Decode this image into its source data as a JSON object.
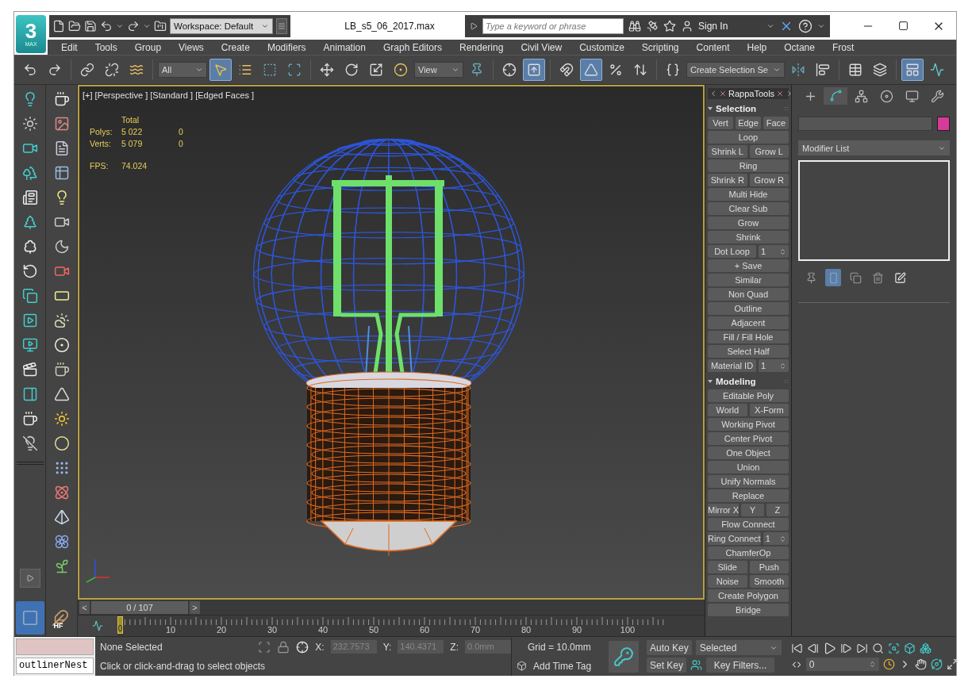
{
  "title_bar": {
    "logo": "3",
    "logo_sub": "MAX",
    "workspace": "Workspace: Default",
    "title": "LB_s5_06_2017.max",
    "search": {
      "placeholder": "Type a keyword or phrase"
    },
    "sign_in": "Sign In"
  },
  "menu": [
    "Edit",
    "Tools",
    "Group",
    "Views",
    "Create",
    "Modifiers",
    "Animation",
    "Graph Editors",
    "Rendering",
    "Civil View",
    "Customize",
    "Scripting",
    "Content",
    "Help",
    "Octane",
    "Frost"
  ],
  "toolbar": [
    {
      "kind": "icon",
      "active": false
    },
    {
      "kind": "icon",
      "active": false
    },
    {
      "kind": "separator"
    },
    {
      "kind": "icon",
      "active": false
    },
    {
      "kind": "icon",
      "active": false
    },
    {
      "kind": "icon",
      "active": false
    },
    {
      "kind": "separator"
    },
    {
      "kind": "dropdown",
      "label": "All"
    },
    {
      "kind": "icon",
      "active": true
    },
    {
      "kind": "icon",
      "active": false
    },
    {
      "kind": "icon",
      "active": false
    },
    {
      "kind": "icon",
      "active": false
    },
    {
      "kind": "separator"
    },
    {
      "kind": "icon",
      "active": false
    },
    {
      "kind": "icon",
      "active": false
    },
    {
      "kind": "icon",
      "active": false
    },
    {
      "kind": "icon",
      "active": false
    },
    {
      "kind": "dropdown",
      "label": "View"
    },
    {
      "kind": "icon",
      "active": false
    },
    {
      "kind": "separator"
    },
    {
      "kind": "icon",
      "active": false
    },
    {
      "kind": "icon",
      "active": true
    },
    {
      "kind": "separator"
    },
    {
      "kind": "icon",
      "active": false
    },
    {
      "kind": "icon",
      "active": true
    },
    {
      "kind": "icon",
      "active": false
    },
    {
      "kind": "icon",
      "active": false
    },
    {
      "kind": "separator"
    },
    {
      "kind": "icon",
      "active": false
    },
    {
      "kind": "dropdown",
      "label": "Create Selection Se"
    },
    {
      "kind": "icon",
      "active": false
    },
    {
      "kind": "icon",
      "active": false
    },
    {
      "kind": "separator"
    },
    {
      "kind": "icon",
      "active": false
    },
    {
      "kind": "icon",
      "active": false
    },
    {
      "kind": "separator"
    },
    {
      "kind": "icon",
      "active": true
    },
    {
      "kind": "icon",
      "active": false
    }
  ],
  "left_toolbar": {
    "hair_badge": "HF"
  },
  "viewport": {
    "label": "[+] [Perspective ] [Standard ] [Edged Faces ]",
    "active": true,
    "stats": {
      "header": "Total",
      "rows": [
        {
          "label": "Polys:",
          "total": "5 022",
          "selected": "0"
        },
        {
          "label": "Verts:",
          "total": "5 079",
          "selected": "0"
        }
      ]
    },
    "fps": {
      "label": "FPS:",
      "value": "74.024"
    }
  },
  "rappa": {
    "title": "RappaTools",
    "sections": [
      {
        "title": "Selection",
        "expanded": true,
        "rows": [
          [
            {
              "kind": "button",
              "label": "Vert"
            },
            {
              "kind": "button",
              "label": "Edge"
            },
            {
              "kind": "button",
              "label": "Face"
            }
          ],
          [
            {
              "kind": "button",
              "label": "Loop"
            }
          ],
          [
            {
              "kind": "button",
              "label": "Shrink L"
            },
            {
              "kind": "button",
              "label": "Grow L"
            }
          ],
          [
            {
              "kind": "button",
              "label": "Ring"
            }
          ],
          [
            {
              "kind": "button",
              "label": "Shrink R"
            },
            {
              "kind": "button",
              "label": "Grow R"
            }
          ],
          [
            {
              "kind": "button",
              "label": "Multi Hide"
            }
          ],
          [
            {
              "kind": "button",
              "label": "Clear Sub"
            }
          ],
          [
            {
              "kind": "button",
              "label": "Grow"
            }
          ],
          [
            {
              "kind": "button",
              "label": "Shrink"
            }
          ],
          [
            {
              "kind": "button",
              "label": "Dot Loop"
            },
            {
              "kind": "spinner",
              "value": "1"
            }
          ],
          [
            {
              "kind": "button",
              "label": "+ Save"
            }
          ],
          [
            {
              "kind": "button",
              "label": "Similar"
            }
          ],
          [
            {
              "kind": "button",
              "label": "Non Quad"
            }
          ],
          [
            {
              "kind": "button",
              "label": "Outline"
            }
          ],
          [
            {
              "kind": "button",
              "label": "Adjacent"
            }
          ],
          [
            {
              "kind": "button",
              "label": "Fill / Fill Hole"
            }
          ],
          [
            {
              "kind": "button",
              "label": "Select Half"
            }
          ],
          [
            {
              "kind": "button",
              "label": "Material ID"
            },
            {
              "kind": "spinner",
              "value": "1"
            }
          ]
        ]
      },
      {
        "title": "Modeling",
        "expanded": true,
        "rows": [
          [
            {
              "kind": "button",
              "label": "Editable Poly"
            }
          ],
          [
            {
              "kind": "button",
              "label": "World"
            },
            {
              "kind": "button",
              "label": "X-Form"
            }
          ],
          [
            {
              "kind": "button",
              "label": "Working Pivot"
            }
          ],
          [
            {
              "kind": "button",
              "label": "Center Pivot"
            }
          ],
          [
            {
              "kind": "button",
              "label": "One Object"
            }
          ],
          [
            {
              "kind": "button",
              "label": "Union"
            }
          ],
          [
            {
              "kind": "button",
              "label": "Unify Normals"
            }
          ],
          [
            {
              "kind": "button",
              "label": "Replace"
            }
          ],
          [
            {
              "kind": "button",
              "label": "Mirror X"
            },
            {
              "kind": "button",
              "label": "Y"
            },
            {
              "kind": "button",
              "label": "Z"
            }
          ],
          [
            {
              "kind": "button",
              "label": "Flow Connect"
            }
          ],
          [
            {
              "kind": "button",
              "label": "Ring Connect"
            },
            {
              "kind": "spinner",
              "value": "1"
            }
          ],
          [
            {
              "kind": "button",
              "label": "ChamferOp"
            }
          ],
          [
            {
              "kind": "button",
              "label": "Slide"
            },
            {
              "kind": "button",
              "label": "Push"
            }
          ],
          [
            {
              "kind": "button",
              "label": "Noise"
            },
            {
              "kind": "button",
              "label": "Smooth"
            }
          ],
          [
            {
              "kind": "button",
              "label": "Create Polygon"
            }
          ],
          [
            {
              "kind": "button",
              "label": "Bridge"
            }
          ]
        ]
      }
    ]
  },
  "command_panel": {
    "tabs": [
      {
        "selected": false
      },
      {
        "selected": true
      },
      {
        "selected": false
      },
      {
        "selected": false
      },
      {
        "selected": false
      },
      {
        "selected": false
      }
    ],
    "modifier_list": "Modifier List",
    "stack_tools": [
      {
        "active": false
      },
      {
        "active": true
      },
      {
        "active": false
      },
      {
        "active": false
      },
      {
        "active": false
      }
    ]
  },
  "time_slider": {
    "prev": "<",
    "label": "0 / 107",
    "next": ">",
    "level": 0
  },
  "ruler": {
    "current": "0",
    "labels": [
      "10",
      "20",
      "30",
      "40",
      "50",
      "60",
      "70",
      "80",
      "90",
      "100"
    ]
  },
  "status": {
    "listener_output": "outlinerNest",
    "selection": "None Selected",
    "prompt": "Click or click-and-drag to select objects",
    "coords": [
      {
        "axis": "X:",
        "value": "232.7573",
        "disabled": true
      },
      {
        "axis": "Y:",
        "value": "140.4371",
        "disabled": true
      },
      {
        "axis": "Z:",
        "value": "0.0mm",
        "disabled": true
      }
    ],
    "grid": "Grid = 10.0mm",
    "time_tag": "Add Time Tag",
    "auto_key": "Auto Key",
    "set_key": "Set Key",
    "key_mode": "Selected",
    "key_filters": "Key Filters...",
    "frame": "0"
  }
}
